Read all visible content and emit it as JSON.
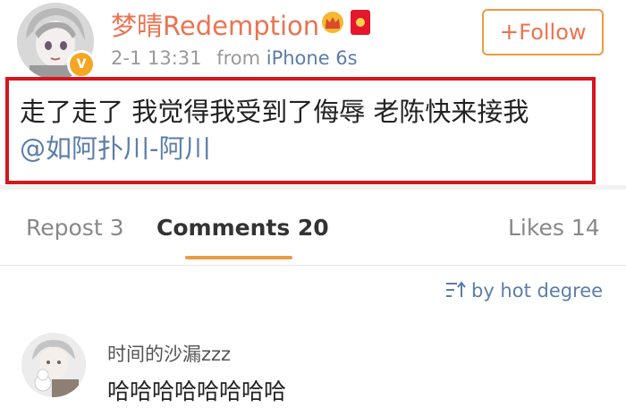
{
  "post": {
    "author": {
      "name": "梦晴Redemption",
      "avatar_icon": "anime-avatar-icon",
      "verified_icon": "verified-badge-icon",
      "vip_icon": "crown-icon",
      "extra_icon": "red-packet-icon"
    },
    "time": "2-1 13:31",
    "from_label": "from",
    "source": "iPhone 6s",
    "follow_label": "Follow",
    "follow_plus": "+",
    "text": "走了走了 我觉得我受到了侮辱 老陈快来接我",
    "mention": "@如阿扑川-阿川",
    "highlight_color": "#d6151d"
  },
  "tabs": [
    {
      "label": "Repost 3",
      "active": false
    },
    {
      "label": "Comments 20",
      "active": true
    },
    {
      "label": "Likes 14",
      "active": false
    }
  ],
  "sort": {
    "label": "by hot degree",
    "icon": "sort-icon"
  },
  "comments": [
    {
      "user": "时间的沙漏zzz",
      "text": "哈哈哈哈哈哈哈哈",
      "avatar_icon": "snowman-avatar-icon"
    }
  ],
  "colors": {
    "accent": "#eb7350",
    "link": "#5b7ea8",
    "tab_underline": "#eb9b44"
  }
}
